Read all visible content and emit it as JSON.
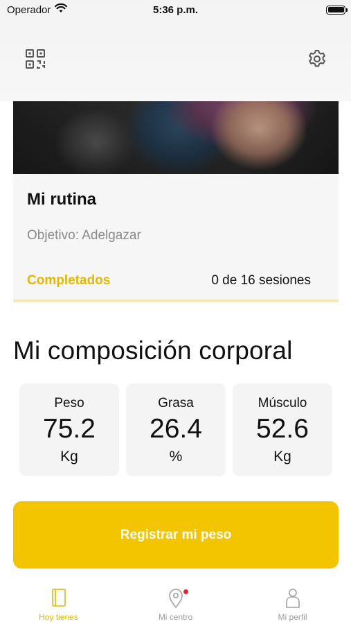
{
  "status_bar": {
    "carrier": "Operador",
    "time": "5:36 p.m."
  },
  "top_bar": {
    "left_icon": "qr-code-icon",
    "right_icon": "gear-icon"
  },
  "routine": {
    "title": "Mi rutina",
    "goal": "Objetivo: Adelgazar",
    "completed_label": "Completados",
    "sessions": "0 de 16 sesiones",
    "progress": 0
  },
  "composition": {
    "title": "Mi composición corporal",
    "metrics": [
      {
        "label": "Peso",
        "value": "75.2",
        "unit": "Kg"
      },
      {
        "label": "Grasa",
        "value": "26.4",
        "unit": "%"
      },
      {
        "label": "Músculo",
        "value": "52.6",
        "unit": "Kg"
      }
    ]
  },
  "register_button": {
    "label": "Registrar mi peso"
  },
  "tabs": [
    {
      "label": "Hoy tienes",
      "icon": "book-icon",
      "active": true
    },
    {
      "label": "Mi centro",
      "icon": "location-pin-icon",
      "active": false,
      "notification": true
    },
    {
      "label": "Mi perfil",
      "icon": "person-icon",
      "active": false
    }
  ],
  "colors": {
    "accent": "#f2c500",
    "accent_text": "#e3b800",
    "notification": "#e8232e"
  }
}
